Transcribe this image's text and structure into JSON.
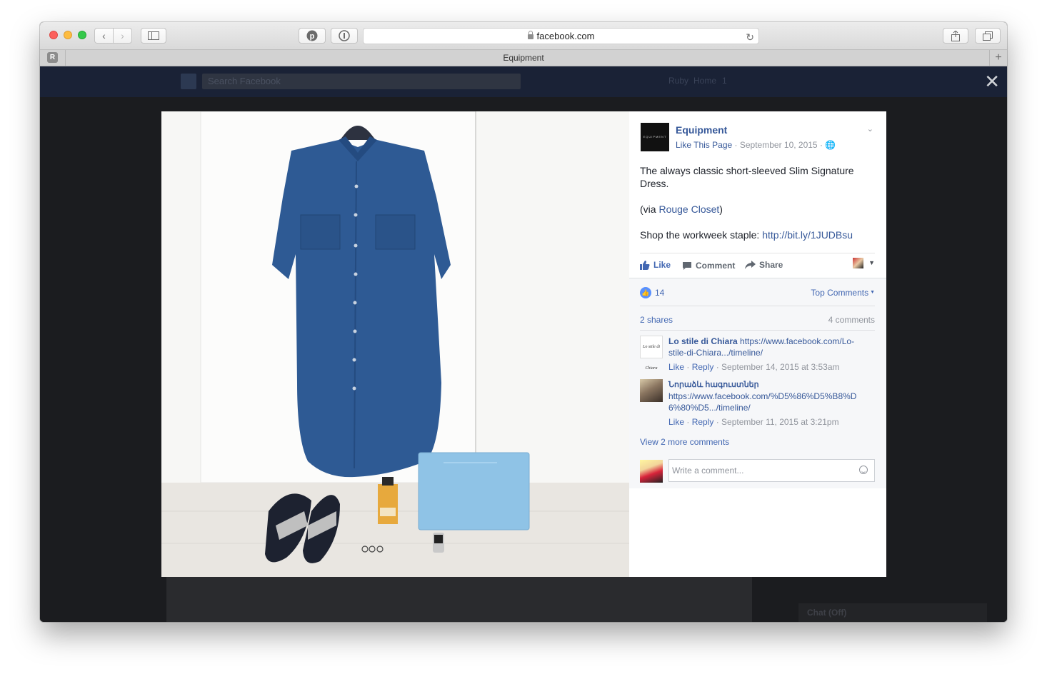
{
  "browser": {
    "url": "facebook.com",
    "tab_title": "Equipment",
    "tab_favicon_letter": "R",
    "new_tab_symbol": "+"
  },
  "facebook_bar": {
    "search_placeholder": "Search Facebook",
    "user_name": "Ruby",
    "home_label": "Home",
    "home_count": "1"
  },
  "post": {
    "page_name": "Equipment",
    "like_page_label": "Like This Page",
    "date": "September 10, 2015",
    "paragraphs": {
      "p1": "The always classic short-sleeved Slim Signature Dress.",
      "p2_prefix": "(via ",
      "p2_link": "Rouge Closet",
      "p2_suffix": ")",
      "p3_prefix": "Shop the workweek staple: ",
      "p3_link": "http://bit.ly/1JUDBsu"
    },
    "actions": {
      "like": "Like",
      "comment": "Comment",
      "share": "Share"
    },
    "like_count": "14",
    "top_comments_label": "Top Comments",
    "shares_label": "2 shares",
    "comments_count_label": "4 comments",
    "comments": [
      {
        "author": "Lo stile di Chiara",
        "link": "https://www.facebook.com/Lo-stile-di-Chiara.../timeline/",
        "like": "Like",
        "reply": "Reply",
        "timestamp": "September 14, 2015 at 3:53am"
      },
      {
        "author": "Նորաձև հագուստներ",
        "link": "https://www.facebook.com/%D5%86%D5%B8%D6%80%D5.../timeline/",
        "like": "Like",
        "reply": "Reply",
        "timestamp": "September 11, 2015 at 3:21pm"
      }
    ],
    "view_more_label": "View 2 more comments",
    "write_placeholder": "Write a comment..."
  },
  "background": {
    "chat_label": "Chat (Off)"
  },
  "colors": {
    "fb_link": "#365899",
    "fb_like_blue": "#4267b2",
    "overlay": "#1b1c1f"
  }
}
